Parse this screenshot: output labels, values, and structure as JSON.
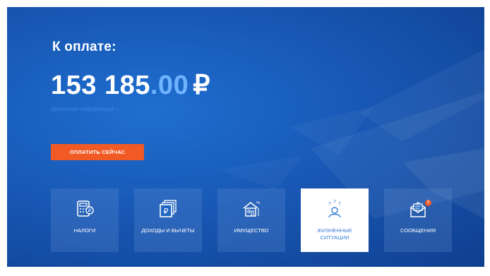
{
  "header": {
    "title": "К оплате:"
  },
  "amount": {
    "integer": "153 185",
    "fraction": ".00",
    "currency": "₽"
  },
  "detail_link": "Детальная информация ›",
  "pay_button": "ОПЛАТИТЬ СЕЙЧАС",
  "tiles": [
    {
      "label": "НАЛОГИ",
      "icon": "calculator-ruble-icon"
    },
    {
      "label": "ДОХОДЫ И ВЫЧЕТЫ",
      "icon": "ruble-bills-icon"
    },
    {
      "label": "ИМУЩЕСТВО",
      "icon": "house-icon"
    },
    {
      "label": "ЖИЗНЕННЫЕ СИТУАЦИИ",
      "icon": "person-questions-icon",
      "active": true
    },
    {
      "label": "СООБЩЕНИЯ",
      "icon": "envelope-icon",
      "badge": "3"
    }
  ],
  "colors": {
    "accent": "#f15a24",
    "background": "#1858b5",
    "highlight": "#6fb3ff"
  }
}
